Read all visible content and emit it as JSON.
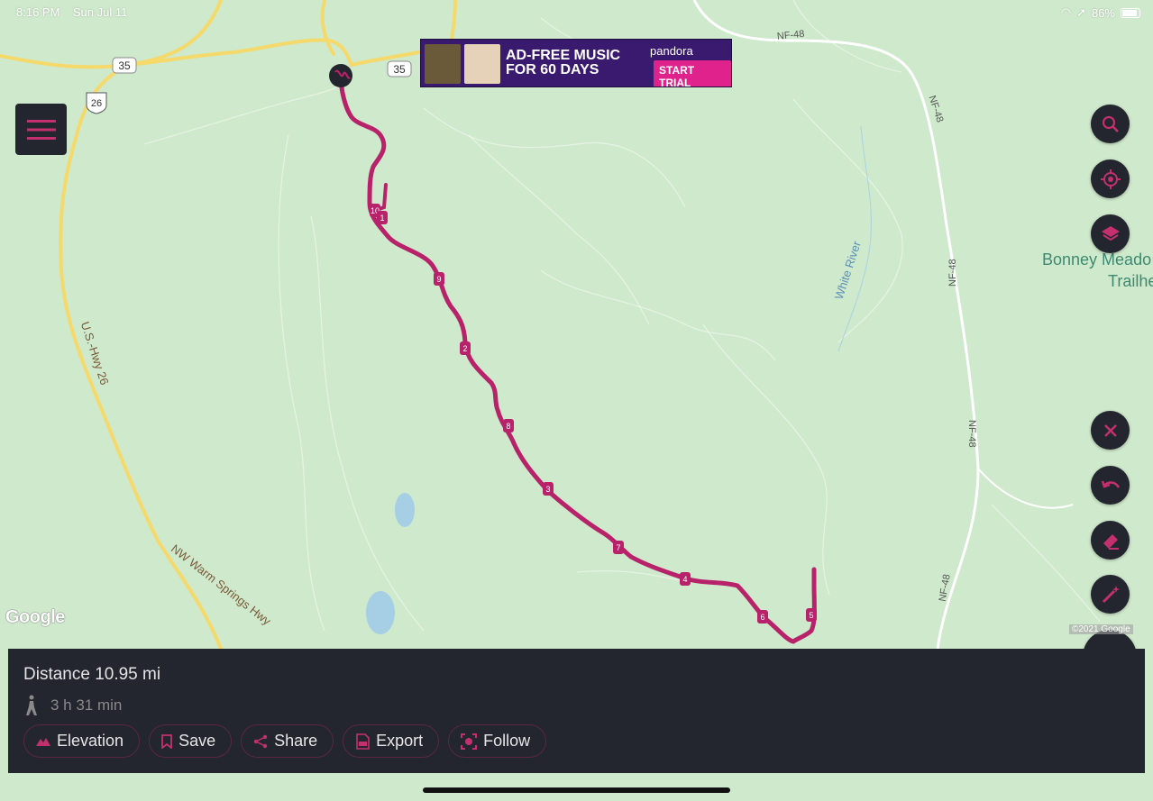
{
  "status_bar": {
    "time": "8:16 PM",
    "date": "Sun Jul 11",
    "battery": "86%"
  },
  "ad": {
    "headline_1": "AD-FREE MUSIC",
    "headline_2": "FOR 60 DAYS",
    "brand": "pandora",
    "cta": "START TRIAL"
  },
  "map": {
    "road_labels": [
      "35",
      "35",
      "26",
      "NF-48",
      "NF-48",
      "NF-48",
      "NF-48",
      "NF-48",
      "U.S.-Hwy 26",
      "NW Warm Springs Hwy",
      "White River"
    ],
    "place_label_1": "Bonney Meado",
    "place_label_2": "Trailhe",
    "mile_markers": [
      "10",
      "1",
      "9",
      "2",
      "8",
      "3",
      "7",
      "4",
      "6",
      "5"
    ],
    "attribution": "Google",
    "copyright": "©2021 Google"
  },
  "route_panel": {
    "distance_label": "Distance 10.95 mi",
    "duration_label": "3 h 31 min",
    "buttons": {
      "elevation": "Elevation",
      "save": "Save",
      "share": "Share",
      "export": "Export",
      "follow": "Follow"
    }
  },
  "colors": {
    "route": "#b8226a",
    "panel": "#23262e",
    "map_bg": "#cfe9cc",
    "road_major": "#f5d96b",
    "water": "#a6cfe6"
  },
  "icons": [
    "menu-icon",
    "search-icon",
    "locate-icon",
    "layers-icon",
    "close-icon",
    "undo-icon",
    "eraser-icon",
    "magic-wand-icon",
    "route-draw-icon",
    "hiker-icon",
    "mountain-icon",
    "bookmark-icon",
    "share-icon",
    "export-icon",
    "follow-icon"
  ]
}
